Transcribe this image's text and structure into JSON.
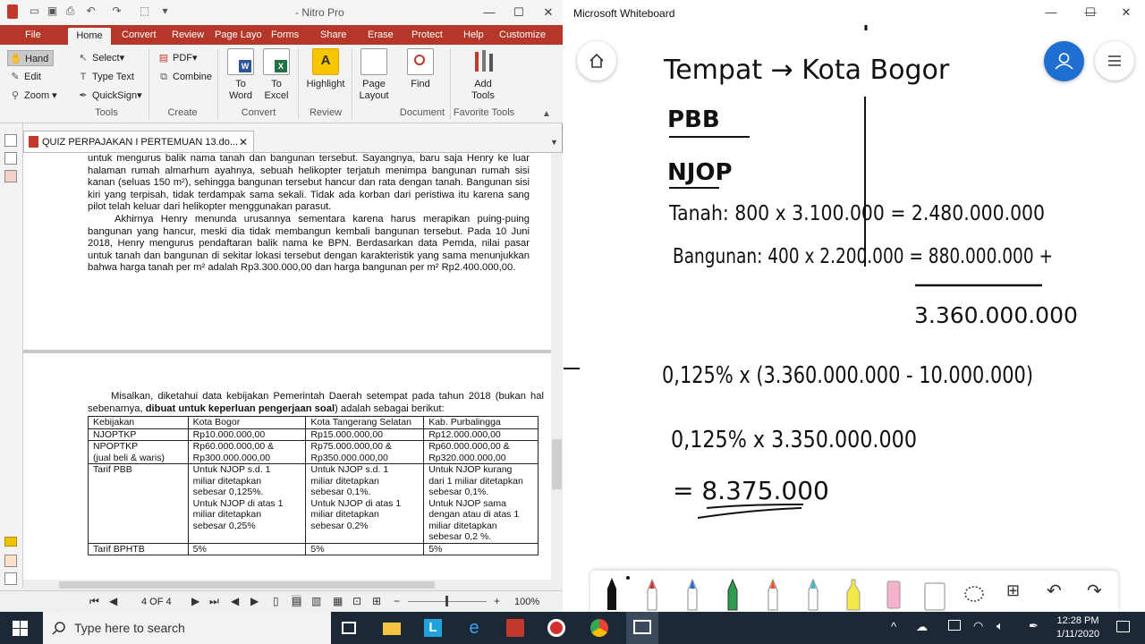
{
  "nitro": {
    "title": "- Nitro Pro",
    "menu": [
      "File",
      "Home",
      "Convert",
      "Review",
      "Page Layo",
      "Forms",
      "Share",
      "Erase",
      "Protect",
      "Help",
      "Customize"
    ],
    "tools": {
      "hand": "Hand",
      "edit": "Edit",
      "zoom": "Zoom",
      "select": "Select",
      "type_text": "Type Text",
      "quicksign": "QuickSign",
      "label": "Tools"
    },
    "create": {
      "pdf": "PDF",
      "combine": "Combine",
      "label": "Create"
    },
    "convert": {
      "to_word": "To\nWord",
      "to_excel": "To\nExcel",
      "label": "Convert"
    },
    "review": {
      "highlight": "Highlight",
      "label": "Review"
    },
    "document": {
      "page_layout": "Page\nLayout",
      "find": "Find",
      "label": "Document"
    },
    "favorite": {
      "add_tools": "Add\nTools",
      "label": "Favorite Tools"
    },
    "doc_tab": "QUIZ PERPAJAKAN I PERTEMUAN 13.do...",
    "page1_paragraphs": [
      "untuk mengurus balik nama tanah dan bangunan tersebut. Sayangnya, baru saja Henry ke luar halaman rumah almarhum ayahnya, sebuah helikopter terjatuh menimpa bangunan rumah sisi kanan (seluas 150 m²), sehingga bangunan tersebut hancur dan rata dengan tanah. Bangunan sisi kiri yang terpisah, tidak terdampak sama sekali. Tidak ada korban dari peristiwa itu karena sang pilot telah keluar dari helikopter menggunakan parasut.",
      "Akhirnya Henry menunda urusannya sementara karena harus merapikan puing-puing bangunan yang hancur, meski dia tidak membangun kembali bangunan tersebut. Pada 10 Juni 2018, Henry mengurus pendaftaran balik nama ke BPN. Berdasarkan data Pemda, nilai pasar untuk tanah dan bangunan di sekitar lokasi tersebut dengan karakteristik yang sama menunjukkan bahwa harga tanah per m² adalah Rp3.300.000,00 dan harga bangunan per m² Rp2.400.000,00."
    ],
    "page2_intro_a": "Misalkan, diketahui data kebijakan Pemerintah Daerah setempat pada tahun 2018 (bukan hal sebenarnya, ",
    "page2_intro_bold": "dibuat untuk keperluan pengerjaan soal",
    "page2_intro_b": ") adalah sebagai berikut:",
    "table": {
      "headers": [
        "Kebijakan",
        "Kota Bogor",
        "Kota Tangerang Selatan",
        "Kab. Purbalingga"
      ],
      "rows": [
        [
          "NJOPTKP",
          "Rp10.000.000,00",
          "Rp15.000.000,00",
          "Rp12.000.000,00"
        ],
        [
          "NPOPTKP\n(jual beli & waris)",
          "Rp60.000.000,00 &\nRp300.000.000,00",
          "Rp75.000.000,00 &\nRp350.000.000,00",
          "Rp60.000.000,00 &\nRp320.000.000,00"
        ],
        [
          "Tarif PBB",
          "Untuk NJOP s.d. 1\nmiliar ditetapkan\nsebesar 0,125%.\nUntuk NJOP di atas 1\nmiliar ditetapkan\nsebesar 0,25%",
          "Untuk NJOP s.d. 1\nmiliar ditetapkan\nsebesar 0,1%.\nUntuk NJOP di atas 1\nmiliar ditetapkan\nsebesar 0,2%",
          "Untuk NJOP kurang\ndari 1 miliar ditetapkan\nsebesar 0,1%.\nUntuk NJOP sama\ndengan atau di atas 1\nmiliar ditetapkan\nsebesar 0,2 %."
        ],
        [
          "Tarif BPHTB",
          "5%",
          "5%",
          "5%"
        ]
      ]
    },
    "page_indicator": "4 OF 4",
    "zoom": "100%"
  },
  "whiteboard": {
    "title": "Microsoft Whiteboard",
    "ink_lines": [
      "Tempat → Kota Bogor",
      "PBB",
      "NJOP",
      "Tanah: 800 x 3.100.000 = 2.480.000.000",
      "Bangunan: 400 x 2.200.000 = 880.000.000 +",
      "3.360.000.000",
      "0,125% x (3.360.000.000 - 10.000.000)",
      "0,125% x 3.350.000.000",
      "= 8.375.000"
    ]
  },
  "taskbar": {
    "search_placeholder": "Type here to search",
    "time": "12:28 PM",
    "date": "1/11/2020"
  }
}
